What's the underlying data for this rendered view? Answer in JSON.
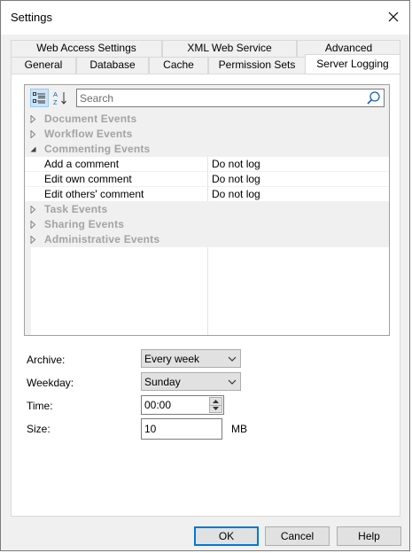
{
  "window": {
    "title": "Settings"
  },
  "tabs": {
    "row_back": [
      "Web Access Settings",
      "XML Web Service",
      "Advanced"
    ],
    "row_front": [
      "General",
      "Database",
      "Cache",
      "Permission Sets",
      "Server Logging"
    ],
    "active": "Server Logging"
  },
  "grid": {
    "search_placeholder": "Search",
    "rows": [
      {
        "type": "category",
        "label": "Document Events",
        "expanded": false
      },
      {
        "type": "category",
        "label": "Workflow Events",
        "expanded": false
      },
      {
        "type": "category",
        "label": "Commenting Events",
        "expanded": true
      },
      {
        "type": "property",
        "name": "Add a comment",
        "value": "Do not log"
      },
      {
        "type": "property",
        "name": "Edit own comment",
        "value": "Do not log"
      },
      {
        "type": "property",
        "name": "Edit others' comment",
        "value": "Do not log"
      },
      {
        "type": "category",
        "label": "Task Events",
        "expanded": false
      },
      {
        "type": "category",
        "label": "Sharing Events",
        "expanded": false
      },
      {
        "type": "category",
        "label": "Administrative Events",
        "expanded": false
      }
    ]
  },
  "fields": {
    "archive": {
      "label": "Archive:",
      "value": "Every week"
    },
    "weekday": {
      "label": "Weekday:",
      "value": "Sunday"
    },
    "time": {
      "label": "Time:",
      "value": "00:00"
    },
    "size": {
      "label": "Size:",
      "value": "10",
      "unit": "MB"
    }
  },
  "buttons": {
    "ok": "OK",
    "cancel": "Cancel",
    "help": "Help"
  },
  "colors": {
    "accent": "#0078d7",
    "disabled_text": "#a3a3a3",
    "panel_bg": "#f0f0f0"
  }
}
